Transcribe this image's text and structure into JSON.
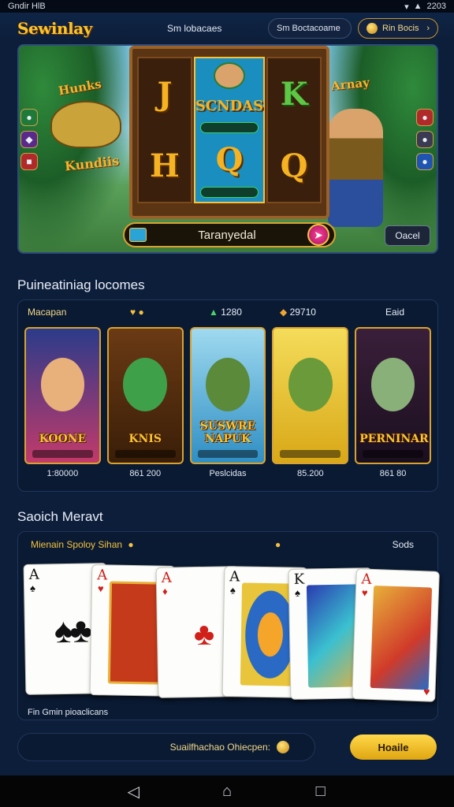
{
  "status_bar": {
    "left": "Gndir  HlB",
    "right": "2203"
  },
  "header": {
    "logo": "Sewinlay",
    "nav_link": "Sm lobacaes",
    "browse_pill": "Sm Boctacoame",
    "coins_pill": "Rin Bocis"
  },
  "hero": {
    "reel_left": [
      "J",
      "H"
    ],
    "reel_mid": [
      "SCNDAS",
      "Q"
    ],
    "reel_right": [
      "K",
      "Q"
    ],
    "spin_label": "Taranyedal",
    "cta_label": "Oacel",
    "art_text_left_top": "Hunks",
    "art_text_left_mid": "Kundiis",
    "art_text_right_top": "Arnay"
  },
  "games_section": {
    "title": "Puineatiniag locomes",
    "head": [
      "Macapan",
      "",
      "1280",
      "29710",
      "Eaid"
    ],
    "cards": [
      {
        "name": "KOONE",
        "price": "1:80000",
        "bg": "#2b3b8a"
      },
      {
        "name": "KNIS",
        "price": "861 200",
        "bg": "#6a3a14"
      },
      {
        "name": "SUSWRE NAPUK",
        "price": "Peslcidas",
        "bg": "#2f8fc4"
      },
      {
        "name": "",
        "price": "85.200",
        "bg": "#e8c52c"
      },
      {
        "name": "PERNINAR",
        "price": "861 80",
        "bg": "#3a1f3a"
      }
    ]
  },
  "cards_section": {
    "title": "Saoich Meravt",
    "head_a": "Mienain Spoloy Sihan",
    "head_c": "Sods",
    "footer": "Fin Gmin pioaclicans",
    "cards": [
      {
        "rank": "A",
        "suit": "♠",
        "color": "#111111"
      },
      {
        "rank": "A",
        "suit": "♥",
        "color": "#d0201a"
      },
      {
        "rank": "A",
        "suit": "♦",
        "color": "#d0201a"
      },
      {
        "rank": "A",
        "suit": "♠",
        "color": "#111111"
      },
      {
        "rank": "K",
        "suit": "♠",
        "color": "#111111"
      },
      {
        "rank": "A",
        "suit": "♥",
        "color": "#d0201a"
      }
    ]
  },
  "bottom": {
    "bar_label": "Suailfhachao Ohiecpen:",
    "home_label": "Hoaile"
  },
  "colors": {
    "accent": "#f3c23f",
    "bg": "#0d1e3a",
    "panel": "#0a1a33"
  }
}
